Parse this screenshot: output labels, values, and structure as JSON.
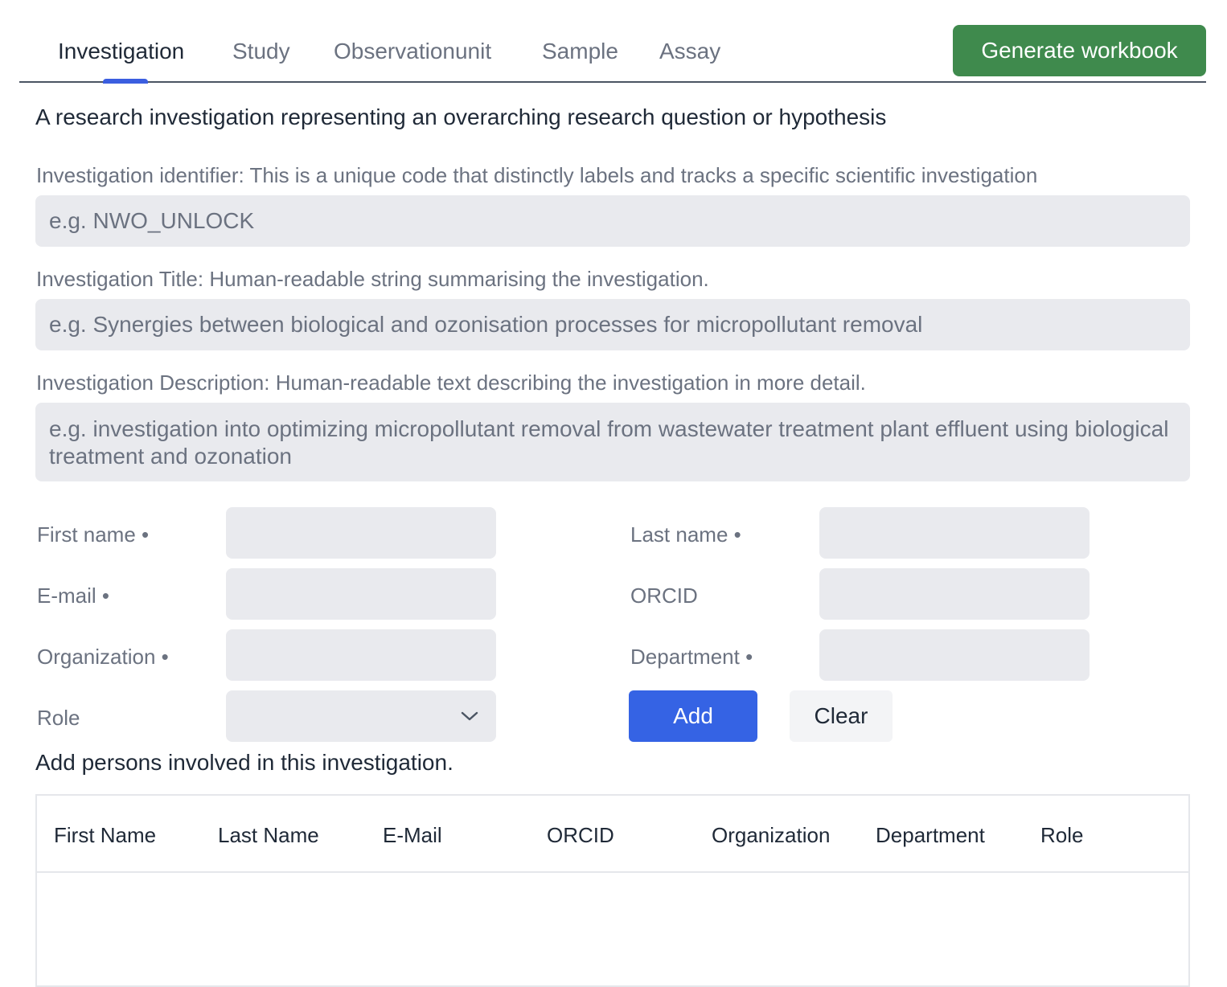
{
  "tabs": [
    {
      "label": "Investigation",
      "active": true
    },
    {
      "label": "Study",
      "active": false
    },
    {
      "label": "Observationunit",
      "active": false
    },
    {
      "label": "Sample",
      "active": false
    },
    {
      "label": "Assay",
      "active": false
    }
  ],
  "toolbar": {
    "generate_label": "Generate workbook",
    "generate_color": "#3f8a4d"
  },
  "investigation": {
    "description": "A research investigation representing an overarching research question or hypothesis",
    "identifier": {
      "label": "Investigation identifier: This is a unique code that distinctly labels and tracks a specific scientific investigation",
      "value": "",
      "placeholder": "e.g. NWO_UNLOCK"
    },
    "title": {
      "label": "Investigation Title: Human-readable string summarising the investigation.",
      "value": "",
      "placeholder": "e.g. Synergies between biological and ozonisation processes for micropollutant removal"
    },
    "description_field": {
      "label": "Investigation Description: Human-readable text describing the investigation in more detail.",
      "value": "",
      "placeholder": "e.g. investigation into optimizing micropollutant removal from wastewater treatment plant effluent using biological treatment and ozonation"
    }
  },
  "person_form": {
    "first_name": {
      "label": "First name •",
      "value": ""
    },
    "last_name": {
      "label": "Last name •",
      "value": ""
    },
    "email": {
      "label": "E-mail •",
      "value": ""
    },
    "orcid": {
      "label": "ORCID",
      "value": ""
    },
    "organization": {
      "label": "Organization •",
      "value": ""
    },
    "department": {
      "label": "Department •",
      "value": ""
    },
    "role": {
      "label": "Role",
      "value": ""
    },
    "add_label": "Add",
    "clear_label": "Clear",
    "add_color": "#3563e4",
    "hint": "Add persons involved in this investigation."
  },
  "persons_table": {
    "columns": [
      "First Name",
      "Last Name",
      "E-Mail",
      "ORCID",
      "Organization",
      "Department",
      "Role"
    ],
    "rows": []
  },
  "icons": {
    "role_dropdown": "chevron-down-icon"
  }
}
